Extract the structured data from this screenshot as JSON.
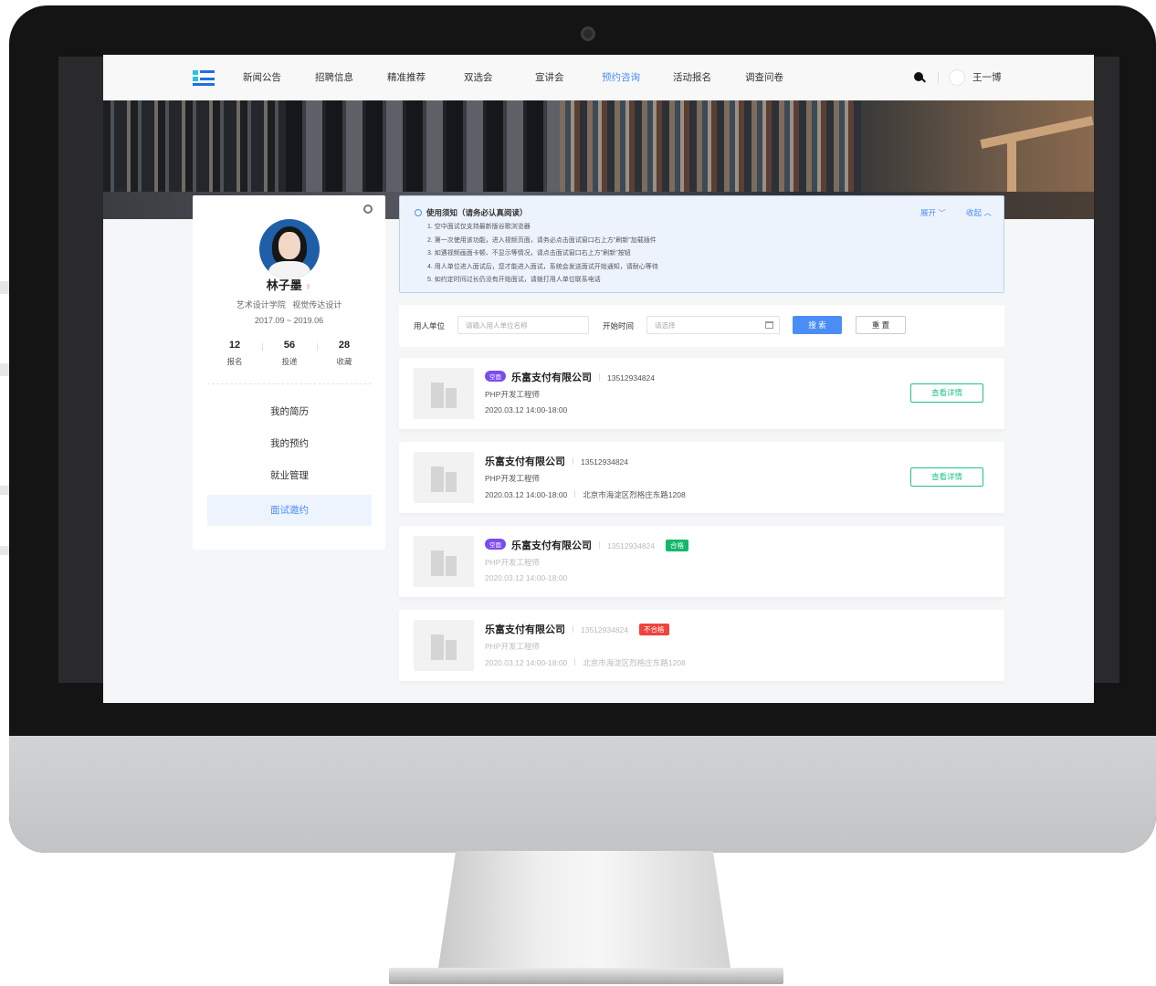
{
  "colors": {
    "accent": "#4a8ef5",
    "success": "#22c08a",
    "pass": "#15b86b",
    "fail": "#f0433e",
    "tag": "#7b4cf0"
  },
  "nav": {
    "items": [
      {
        "label": "新闻公告",
        "active": false
      },
      {
        "label": "招聘信息",
        "active": false
      },
      {
        "label": "精准推荐",
        "active": false
      },
      {
        "label": "双选会",
        "active": false
      },
      {
        "label": "宣讲会",
        "active": false
      },
      {
        "label": "预约咨询",
        "active": true
      },
      {
        "label": "活动报名",
        "active": false
      },
      {
        "label": "调查问卷",
        "active": false
      }
    ],
    "search_icon": "search-icon",
    "user_name": "王一博"
  },
  "profile": {
    "name": "林子墨",
    "gender_symbol": "♀",
    "college": "艺术设计学院",
    "major": "视觉传达设计",
    "period": "2017.09 ~ 2019.06",
    "stats": [
      {
        "value": "12",
        "label": "报名"
      },
      {
        "value": "56",
        "label": "投递"
      },
      {
        "value": "28",
        "label": "收藏"
      }
    ],
    "menu": [
      {
        "label": "我的简历",
        "active": false
      },
      {
        "label": "我的预约",
        "active": false
      },
      {
        "label": "就业管理",
        "active": false
      },
      {
        "label": "面试邀约",
        "active": true
      }
    ]
  },
  "notice": {
    "title": "使用须知（请务必认真阅读）",
    "expand": "展开 ﹀",
    "collapse": "收起 ︿",
    "lines": [
      "1. 空中面试仅支持最新版谷歌浏览器",
      "2. 第一次使用该功能，进入视频页面，请务必点击面试窗口右上方\"刷新\"加载插件",
      "3. 如遇视频画面卡顿、不显示等情况，请点击面试窗口右上方\"刷新\"按钮",
      "4. 用人单位进入面试后，您才能进入面试，系统会发送面试开始通知，请耐心等待",
      "5. 如约定时间过长仍没有开始面试，请拨打用人单位联系电话"
    ]
  },
  "filter": {
    "employer_label": "用人单位",
    "employer_placeholder": "请输入用人单位名称",
    "time_label": "开始时间",
    "time_placeholder": "请选择",
    "search_btn": "搜 索",
    "reset_btn": "重 置"
  },
  "cards": [
    {
      "tag": "空面",
      "company": "乐富支付有限公司",
      "phone": "13512934824",
      "position": "PHP开发工程师",
      "time": "2020.03.12 14:00-18:00",
      "address": "",
      "status": "",
      "button": "查看详情"
    },
    {
      "tag": "",
      "company": "乐富支付有限公司",
      "phone": "13512934824",
      "position": "PHP开发工程师",
      "time": "2020.03.12 14:00-18:00",
      "address": "北京市海淀区烈格庄东路1208",
      "status": "",
      "button": "查看详情"
    },
    {
      "tag": "空面",
      "company": "乐富支付有限公司",
      "phone": "13512934824",
      "position": "PHP开发工程师",
      "time": "2020.03.12 14:00-18:00",
      "address": "",
      "status": "合格",
      "button": ""
    },
    {
      "tag": "",
      "company": "乐富支付有限公司",
      "phone": "13512934824",
      "position": "PHP开发工程师",
      "time": "2020.03.12 14:00-18:00",
      "address": "北京市海淀区烈格庄东路1208",
      "status": "不合格",
      "button": ""
    }
  ]
}
